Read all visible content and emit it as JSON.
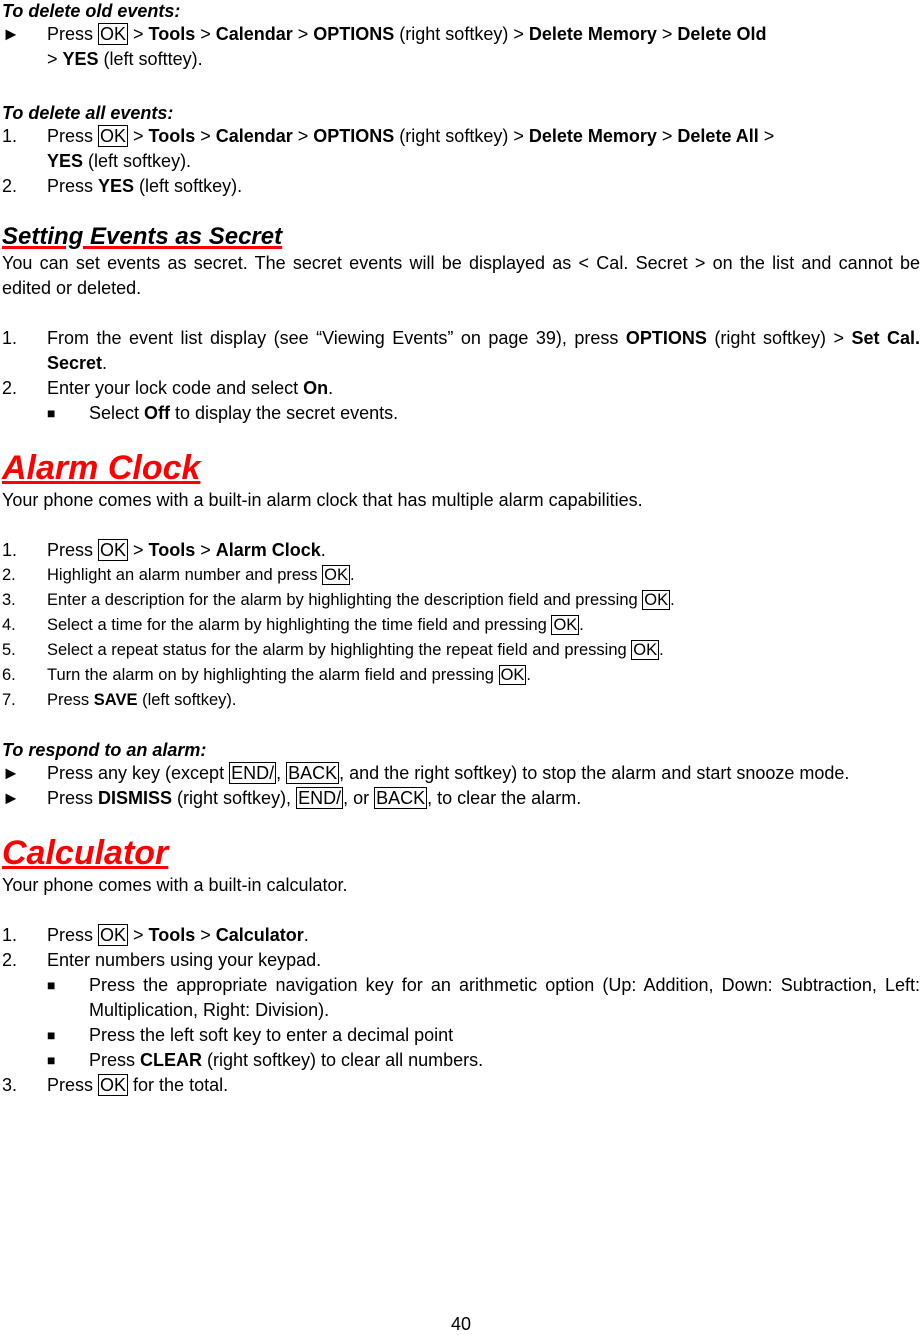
{
  "delete_old": {
    "heading": "To delete old events:",
    "step": {
      "marker": "►",
      "press": "Press ",
      "ok": "OK",
      "sep": " > ",
      "tools": "Tools",
      "calendar": "Calendar",
      "options": "OPTIONS",
      "right_softkey": " (right softkey) > ",
      "delete_memory": "Delete Memory",
      "delete_old": "Delete Old",
      "yes": "YES",
      "left_softtey": " (left softtey)."
    }
  },
  "delete_all": {
    "heading": "To delete all events:",
    "step1": {
      "marker": "1.",
      "press": "Press ",
      "ok": "OK",
      "tools": "Tools",
      "calendar": "Calendar",
      "options": "OPTIONS",
      "right_softkey": " (right softkey) > ",
      "delete_memory": "Delete Memory",
      "delete_all": "Delete All",
      "yes": "YES",
      "left_softkey": " (left softkey)."
    },
    "step2": {
      "marker": "2.",
      "press": "Press ",
      "yes": "YES",
      "left_softkey": " (left softkey)."
    }
  },
  "secret": {
    "title": "Setting Events as Secret",
    "intro": "You can set events as secret. The secret events will be displayed as < Cal. Secret > on the list and cannot be edited or deleted.",
    "step1": {
      "marker": "1.",
      "text": "From the event list display (see “Viewing Events” on page 39), press ",
      "options": "OPTIONS",
      "mid": " (right softkey) > ",
      "set": "Set Cal. Secret",
      "end": "."
    },
    "step2": {
      "marker": "2.",
      "text": "Enter your lock code and select ",
      "on": "On",
      "end": "."
    },
    "bullet": {
      "marker": "■",
      "text1": "Select ",
      "off": "Off",
      "text2": " to display the secret events."
    }
  },
  "alarm": {
    "title": "Alarm Clock",
    "intro": "Your phone comes with a built-in alarm clock that has multiple alarm capabilities.",
    "step1": {
      "marker": "1.",
      "press": "Press ",
      "ok": "OK",
      "tools": "Tools",
      "alarm_clock": "Alarm Clock",
      "end": "."
    },
    "step2": {
      "marker": "2.",
      "text": "Highlight an alarm number and press ",
      "ok": "OK",
      "end": "."
    },
    "step3": {
      "marker": "3.",
      "text": "Enter a description for the alarm by highlighting the description field and pressing ",
      "ok": "OK",
      "end": "."
    },
    "step4": {
      "marker": "4.",
      "text": "Select a time for the alarm by highlighting the time field and pressing ",
      "ok": "OK",
      "end": "."
    },
    "step5": {
      "marker": "5.",
      "text": "Select a repeat status for the alarm by highlighting the repeat field and pressing ",
      "ok": "OK",
      "end": "."
    },
    "step6": {
      "marker": "6.",
      "text": "Turn the alarm on by highlighting the alarm field and pressing ",
      "ok": "OK",
      "end": "."
    },
    "step7": {
      "marker": "7.",
      "press": "Press ",
      "save": "SAVE",
      "end": " (left softkey)."
    }
  },
  "respond": {
    "heading": "To respond to an alarm:",
    "item1": {
      "marker": "►",
      "text1": "Press any key (except ",
      "end_key": "END/",
      "comma": ", ",
      "back": "BACK",
      "text2": ", and the right softkey) to stop the alarm and start snooze mode."
    },
    "item2": {
      "marker": "►",
      "press": "Press ",
      "dismiss": "DISMISS",
      "text1": " (right softkey), ",
      "end_key": "END/",
      "or": ", or ",
      "back": "BACK",
      "text2": ", to clear the alarm."
    }
  },
  "calculator": {
    "title": "Calculator",
    "intro": "Your phone comes with a built-in calculator.",
    "step1": {
      "marker": "1.",
      "press": "Press ",
      "ok": "OK",
      "tools": "Tools",
      "calc": "Calculator",
      "end": "."
    },
    "step2": {
      "marker": "2.",
      "text": "Enter numbers using your keypad."
    },
    "bullet1": {
      "marker": "■",
      "text": "Press the appropriate navigation key for an arithmetic option (Up: Addition, Down: Subtraction, Left: Multiplication, Right: Division)."
    },
    "bullet2": {
      "marker": "■",
      "text": "Press the left soft key to enter a decimal point"
    },
    "bullet3": {
      "marker": "■",
      "press": "Press ",
      "clear": "CLEAR",
      "text": " (right softkey) to clear all numbers."
    },
    "step3": {
      "marker": "3.",
      "press": "Press ",
      "ok": "OK",
      "text": " for the total."
    }
  },
  "page_number": "40"
}
